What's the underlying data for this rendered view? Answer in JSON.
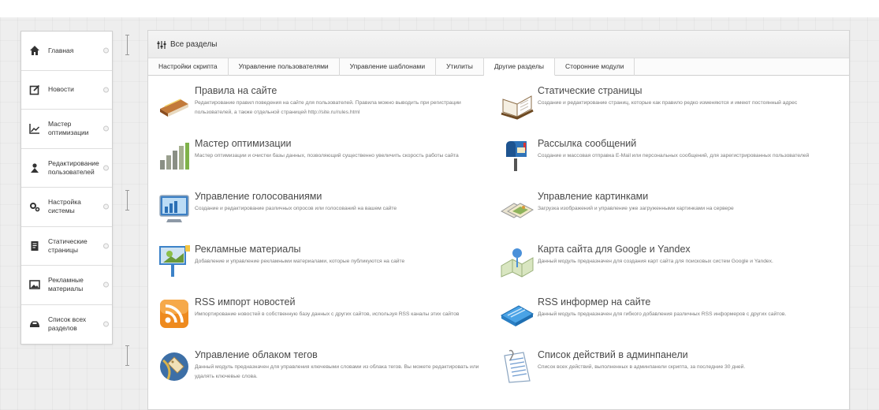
{
  "sidebar": {
    "items": [
      {
        "label": "Главная"
      },
      {
        "label": "Новости"
      },
      {
        "label": "Мастер оптимизации"
      },
      {
        "label": "Редактирование пользователей"
      },
      {
        "label": "Настройка системы"
      },
      {
        "label": "Статические страницы"
      },
      {
        "label": "Рекламные материалы"
      },
      {
        "label": "Список всех разделов"
      }
    ]
  },
  "panel": {
    "title": "Все разделы",
    "tabs": [
      {
        "label": "Настройки скрипта"
      },
      {
        "label": "Управление пользователями"
      },
      {
        "label": "Управление шаблонами"
      },
      {
        "label": "Утилиты"
      },
      {
        "label": "Другие разделы"
      },
      {
        "label": "Сторонние модули"
      }
    ],
    "modules": [
      {
        "title": "Правила на сайте",
        "desc": "Редактирование правил поведения на сайте для пользователей. Правила можно выводить при регистрации пользователей, а также отдельной страницей http://site.ru/rules.html",
        "icon": "book-icon"
      },
      {
        "title": "Статические страницы",
        "desc": "Создание и редактирование страниц, которые как правило редко изменяются и имеют постоянный адрес",
        "icon": "open-book-icon"
      },
      {
        "title": "Мастер оптимизации",
        "desc": "Мастер оптимизации и очистки базы данных, позволяющий существенно увеличить скорость работы сайта",
        "icon": "bar-graph-icon"
      },
      {
        "title": "Рассылка сообщений",
        "desc": "Создание и массовая отправка E-Mail или персональных сообщений, для зарегистрированных пользователей",
        "icon": "mailbox-icon"
      },
      {
        "title": "Управление голосованиями",
        "desc": "Создание и редактирование различных опросов или голосований на вашем сайте",
        "icon": "monitor-chart-icon"
      },
      {
        "title": "Управление картинками",
        "desc": "Загрузка изображений и управление уже загруженными картинками на сервере",
        "icon": "photos-icon"
      },
      {
        "title": "Рекламные материалы",
        "desc": "Добавление и управление рекламными материалами, которые публикуются на сайте",
        "icon": "billboard-icon"
      },
      {
        "title": "Карта сайта для Google и Yandex",
        "desc": "Данный модуль предназначен для создания карт сайта для поисковых систем Google и Yandex.",
        "icon": "map-pin-icon"
      },
      {
        "title": "RSS импорт новостей",
        "desc": "Импортирование новостей в собственную базу данных с других сайтов, используя RSS каналы этих сайтов",
        "icon": "rss-icon"
      },
      {
        "title": "RSS информер на сайте",
        "desc": "Данный модуль предназначен для гибкого добавления различных RSS информеров с других сайтов.",
        "icon": "rss-device-icon"
      },
      {
        "title": "Управление облаком тегов",
        "desc": "Данный модуль предназначен для управления ключевыми словами из облака тегов. Вы можете редактировать или удалять ключевые слова.",
        "icon": "tag-cloud-icon"
      },
      {
        "title": "Список действий в админпанели",
        "desc": "Список всех действий, выполненных в админпанели скрипта, за последние 30 дней.",
        "icon": "document-list-icon"
      }
    ]
  }
}
